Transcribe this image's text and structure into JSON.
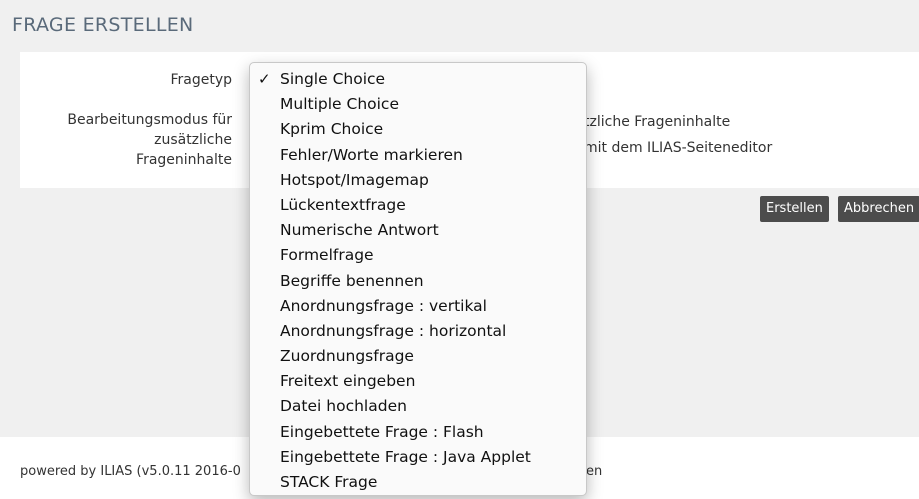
{
  "panel": {
    "title": "FRAGE ERSTELLEN"
  },
  "form": {
    "fragetyp_label": "Fragetyp",
    "mode_label_lines": [
      "Bearbeitungsmodus für",
      "zusätzliche",
      "Frageninhalte"
    ],
    "behind_option_1": "tzliche Frageninhalte",
    "behind_option_2": "mit dem ILIAS-Seiteneditor"
  },
  "buttons": {
    "create": "Erstellen",
    "cancel": "Abbrechen"
  },
  "footer": {
    "text": "powered by ILIAS (v5.0.11 2016-0",
    "tail": "en"
  },
  "dropdown": {
    "selected_index": 0,
    "check_glyph": "✓",
    "options": [
      "Single Choice",
      "Multiple Choice",
      "Kprim Choice",
      "Fehler/Worte markieren",
      "Hotspot/Imagemap",
      "Lückentextfrage",
      "Numerische Antwort",
      "Formelfrage",
      "Begriffe benennen",
      "Anordnungsfrage : vertikal",
      "Anordnungsfrage : horizontal",
      "Zuordnungsfrage",
      "Freitext eingeben",
      "Datei hochladen",
      "Eingebettete Frage : Flash",
      "Eingebettete Frage : Java Applet",
      "STACK Frage"
    ]
  }
}
